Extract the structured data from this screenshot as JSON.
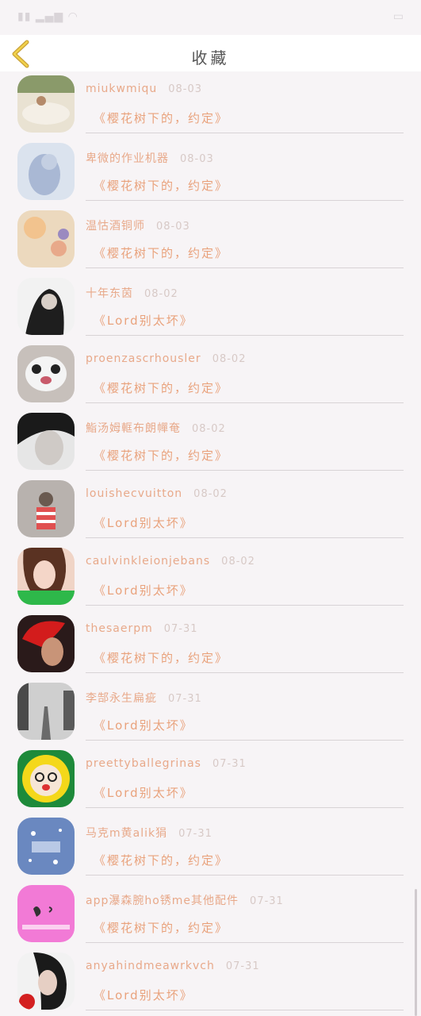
{
  "header": {
    "title": "收藏"
  },
  "items": [
    {
      "name": "miukwmiqu",
      "date": "08-03",
      "work": "《樱花树下的，约定》",
      "avatar_color": "#d8c9b4"
    },
    {
      "name": "卑微的作业机器",
      "date": "08-03",
      "work": "《樱花树下的，约定》",
      "avatar_color": "#c8d3e6"
    },
    {
      "name": "温怙酒铜师",
      "date": "08-03",
      "work": "《樱花树下的，约定》",
      "avatar_color": "#e6c7a4"
    },
    {
      "name": "十年东茵",
      "date": "08-02",
      "work": "《Lord别太坏》",
      "avatar_color": "#3a3a3a"
    },
    {
      "name": "proenzascrhousler",
      "date": "08-02",
      "work": "《樱花树下的，约定》",
      "avatar_color": "#9a8f8a"
    },
    {
      "name": "鮨汤姆軭布朗幝奄",
      "date": "08-02",
      "work": "《樱花树下的，约定》",
      "avatar_color": "#2b2b2b"
    },
    {
      "name": "louishecvuitton",
      "date": "08-02",
      "work": "《Lord别太坏》",
      "avatar_color": "#9c9592"
    },
    {
      "name": "caulvinkleionjebans",
      "date": "08-02",
      "work": "《Lord别太坏》",
      "avatar_color": "#d89b82"
    },
    {
      "name": "thesaerpm",
      "date": "07-31",
      "work": "《樱花树下的，约定》",
      "avatar_color": "#b01616"
    },
    {
      "name": "李郜永生扁疵",
      "date": "07-31",
      "work": "《Lord别太坏》",
      "avatar_color": "#8d8d8d"
    },
    {
      "name": "preettyballegrinas",
      "date": "07-31",
      "work": "《Lord别太坏》",
      "avatar_color": "#f0d61a"
    },
    {
      "name": "马克m黄alik狷",
      "date": "07-31",
      "work": "《樱花树下的，约定》",
      "avatar_color": "#5a78a8"
    },
    {
      "name": "app瀑森腕ho锈me其他配件",
      "date": "07-31",
      "work": "《樱花树下的，约定》",
      "avatar_color": "#f07ad8"
    },
    {
      "name": "anyahindmeawrkvch",
      "date": "07-31",
      "work": "《Lord别太坏》",
      "avatar_color": "#eeeeee"
    }
  ]
}
